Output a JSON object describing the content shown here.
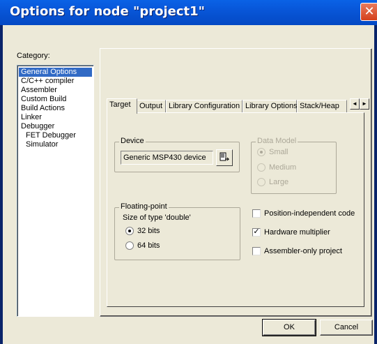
{
  "window": {
    "title": "Options for node \"project1\"",
    "close_glyph": "✕"
  },
  "category": {
    "label": "Category:",
    "items": [
      {
        "label": "General Options",
        "selected": true
      },
      {
        "label": "C/C++ compiler"
      },
      {
        "label": "Assembler"
      },
      {
        "label": "Custom Build"
      },
      {
        "label": "Build Actions"
      },
      {
        "label": "Linker"
      },
      {
        "label": "Debugger"
      },
      {
        "label": "FET Debugger",
        "indent": true
      },
      {
        "label": "Simulator",
        "indent": true
      }
    ]
  },
  "tabs": [
    {
      "label": "Target",
      "active": true
    },
    {
      "label": "Output"
    },
    {
      "label": "Library Configuration"
    },
    {
      "label": "Library Options"
    },
    {
      "label": "Stack/Heap"
    }
  ],
  "tab_scroll": {
    "left": "◄",
    "right": "►"
  },
  "device": {
    "group_title": "Device",
    "value": "Generic MSP430 device"
  },
  "data_model": {
    "group_title": "Data Model",
    "options": [
      {
        "label": "Small",
        "selected": true
      },
      {
        "label": "Medium",
        "selected": false
      },
      {
        "label": "Large",
        "selected": false
      }
    ]
  },
  "floating_point": {
    "group_title": "Floating-point",
    "subtitle": "Size of type 'double'",
    "options": [
      {
        "label": "32 bits",
        "selected": true
      },
      {
        "label": "64 bits",
        "selected": false
      }
    ]
  },
  "checkboxes": [
    {
      "label": "Position-independent code",
      "checked": false
    },
    {
      "label": "Hardware multiplier",
      "checked": true
    },
    {
      "label": "Assembler-only project",
      "checked": false
    }
  ],
  "buttons": {
    "ok": "OK",
    "cancel": "Cancel"
  },
  "colors": {
    "title_bar": "#0a56d8",
    "dialog_bg": "#ece9d8",
    "selection": "#316ac5"
  }
}
